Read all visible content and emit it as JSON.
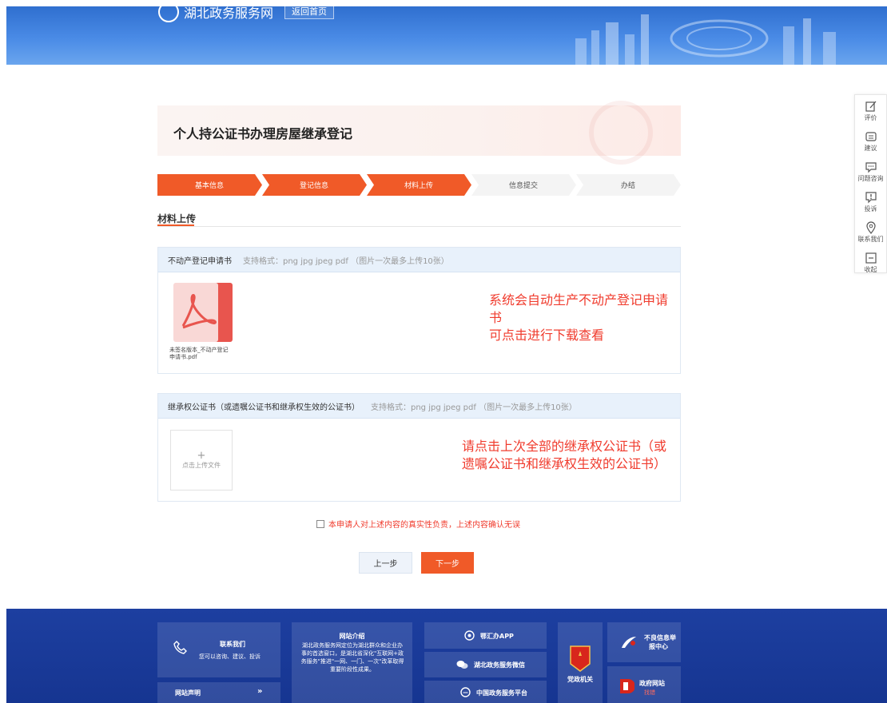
{
  "header": {
    "site_name": "湖北政务服务网",
    "back_label": "返回首页"
  },
  "sidebar": {
    "items": [
      {
        "label": "评价",
        "icon": "edit-icon"
      },
      {
        "label": "建议",
        "icon": "suggestion-icon"
      },
      {
        "label": "问题咨询",
        "icon": "chat-icon"
      },
      {
        "label": "投诉",
        "icon": "complaint-icon"
      },
      {
        "label": "联系我们",
        "icon": "location-icon"
      },
      {
        "label": "收起",
        "icon": "collapse-icon"
      }
    ]
  },
  "page_title": "个人持公证书办理房屋继承登记",
  "steps": [
    {
      "label": "基本信息",
      "state": "done"
    },
    {
      "label": "登记信息",
      "state": "done"
    },
    {
      "label": "材料上传",
      "state": "active"
    },
    {
      "label": "信息提交",
      "state": "pending"
    },
    {
      "label": "办结",
      "state": "pending"
    }
  ],
  "colors": {
    "accent": "#f05a28",
    "note": "#f03c2e",
    "header_blue": "#2f6fcf",
    "footer_blue": "#1d3fa0"
  },
  "section_title": "材料上传",
  "panel1": {
    "title": "不动产登记申请书",
    "format": "支持格式：png jpg jpeg pdf （图片一次最多上传10张）",
    "file_name": "未签名版本_不动产登记申请书.pdf",
    "note_line1": "系统会自动生产不动产登记申请书",
    "note_line2": "可点击进行下载查看"
  },
  "panel2": {
    "title": "继承权公证书（或遗嘱公证书和继承权生效的公证书）",
    "format": "支持格式：png jpg jpeg pdf （图片一次最多上传10张）",
    "upload_plus": "+",
    "upload_label": "点击上传文件",
    "note_line1": "请点击上次全部的继承权公证书（或",
    "note_line2": "遗嘱公证书和继承权生效的公证书）"
  },
  "confirm_text": "本申请人对上述内容的真实性负责，上述内容确认无误",
  "buttons": {
    "prev": "上一步",
    "next": "下一步"
  },
  "footer": {
    "contact_title": "联系我们",
    "contact_sub": "您可以咨询、建议、投诉",
    "statement": "网站声明",
    "statement_arrow": "»",
    "intro_title": "网站介绍",
    "intro_text": "湖北政务服务网定位为湖北群众和企业办事的首选窗口，是湖北省深化\"互联网+政务服务\"推进\"一网、一门、一次\"改革取得重要阶段性成果。",
    "app": "鄂汇办APP",
    "wechat": "湖北政务服务微信",
    "national": "中国政务服务平台",
    "party": "党政机关",
    "report_line1": "不良信息举",
    "report_line2": "报中心",
    "gov_site": "政府网站",
    "gov_site_sub": "找错"
  }
}
